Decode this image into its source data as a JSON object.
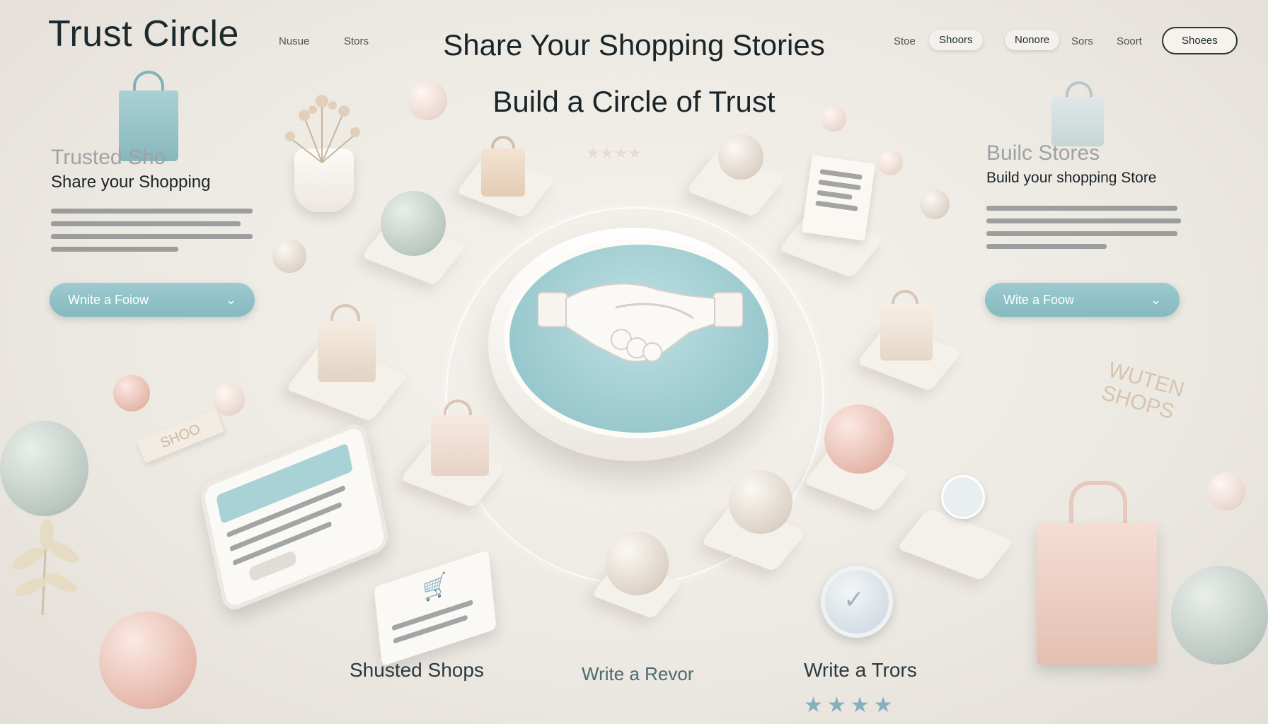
{
  "header": {
    "brand": "Trust Circle",
    "nav_left": [
      "Nusue",
      "Stors"
    ],
    "nav_right": [
      "Stoe",
      "Shoors",
      "Nonore",
      "Sors",
      "Soort"
    ],
    "cta_outline": "Shoees"
  },
  "hero": {
    "title": "Share Your Shopping Stories",
    "subtitle": "Build a Circle of Trust"
  },
  "left_panel": {
    "faded_title": "Trusted  Sho",
    "heading": "Share your Shopping",
    "button_label": "Wnite a Foiow",
    "button_icon": "chevron-down-icon"
  },
  "right_panel": {
    "faded_title": "Builc    Stores",
    "heading": "Build your shopping Store",
    "button_label": "Wite a Foow",
    "button_icon": "chevron-down-icon"
  },
  "decor": {
    "sign_left": "SHOO",
    "sign_right_line1": "WUTEN",
    "sign_right_line2": "SHOPS",
    "rating_stars": "★★★★"
  },
  "footer": {
    "label_1": "Shusted Shops",
    "label_2": "Write a Revor",
    "label_3": "Write a Trors",
    "stars": "★★★★"
  },
  "colors": {
    "accent": "#96c7cc",
    "background": "#ece8e2",
    "blush": "#e6b8ab",
    "sage": "#bcc8c2"
  }
}
